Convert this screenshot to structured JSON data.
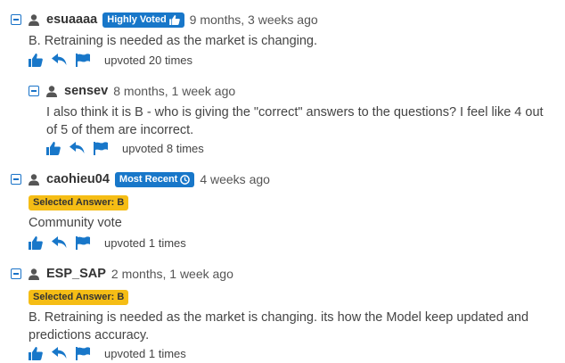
{
  "comments": [
    {
      "username": "esuaaaa",
      "badge": "Highly Voted",
      "time": "9 months, 3 weeks ago",
      "text": "B. Retraining is needed as the market is changing.",
      "upvotes": "upvoted 20 times"
    },
    {
      "username": "sensev",
      "time": "8 months, 1 week ago",
      "text": "I also think it is B - who is giving the \"correct\" answers to the questions? I feel like 4 out of 5 of them are incorrect.",
      "upvotes": "upvoted 8 times"
    },
    {
      "username": "caohieu04",
      "badge": "Most Recent",
      "time": "4 weeks ago",
      "selected": "Selected Answer: B",
      "text": "Community vote",
      "upvotes": "upvoted 1 times"
    },
    {
      "username": "ESP_SAP",
      "time": "2 months, 1 week ago",
      "selected": "Selected Answer: B",
      "text": "B. Retraining is needed as the market is changing. its how the Model keep updated and predictions accuracy.",
      "upvotes": "upvoted 1 times"
    }
  ],
  "colors": {
    "accent": "#1877c9",
    "selected_badge": "#f5bd15"
  },
  "icons": [
    "collapse-icon",
    "user-icon",
    "thumbs-up-icon",
    "reply-icon",
    "flag-icon",
    "clock-icon"
  ]
}
